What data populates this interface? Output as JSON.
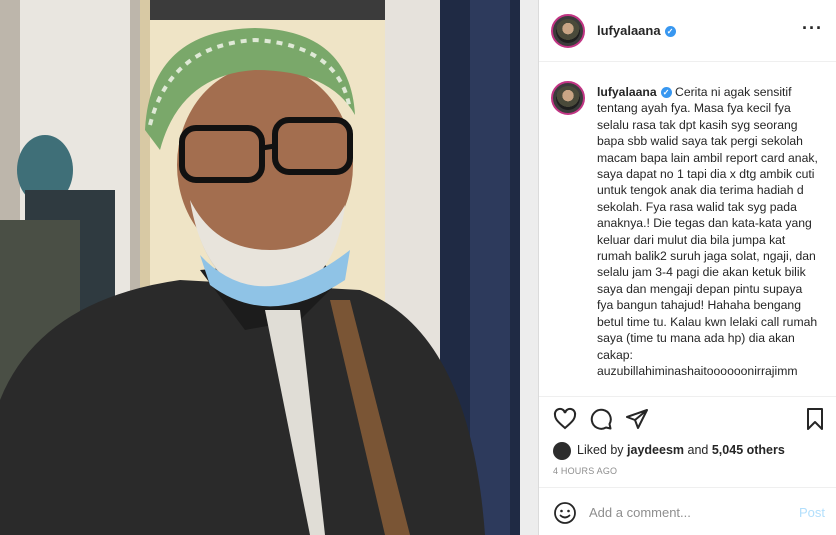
{
  "post": {
    "username": "lufyalaana",
    "verified": true,
    "caption_user": "lufyalaana",
    "caption": "Cerita ni agak sensitif tentang ayah fya. Masa fya kecil fya selalu rasa tak dpt kasih syg seorang bapa sbb walid saya tak pergi sekolah macam bapa lain ambil report card anak, saya dapat no 1 tapi dia x dtg ambik cuti untuk tengok anak dia terima hadiah d sekolah. Fya rasa walid tak syg pada anaknya.! Die tegas dan kata-kata yang keluar dari mulut dia bila jumpa kat rumah balik2 suruh jaga solat, ngaji, dan selalu jam 3-4 pagi die akan ketuk bilik saya dan mengaji depan pintu supaya fya bangun tahajud! Hahaha bengang betul time tu. Kalau kwn lelaki call rumah saya (time tu mana ada hp) dia akan cakap: auzubillahiminashaitoooooonirrajimm",
    "likes": {
      "prefix": "Liked by",
      "user": "jaydeesm",
      "joiner": "and",
      "others": "5,045 others"
    },
    "time": "4 HOURS AGO"
  },
  "comment": {
    "placeholder": "Add a comment...",
    "post_label": "Post"
  },
  "icons": [
    "more-icon",
    "heart-icon",
    "comment-icon",
    "share-icon",
    "bookmark-icon",
    "smile-icon",
    "verified-icon"
  ],
  "colors": {
    "verified": "#3897f0",
    "post_disabled": "#b2dffc",
    "muted": "#8e8e8e"
  }
}
